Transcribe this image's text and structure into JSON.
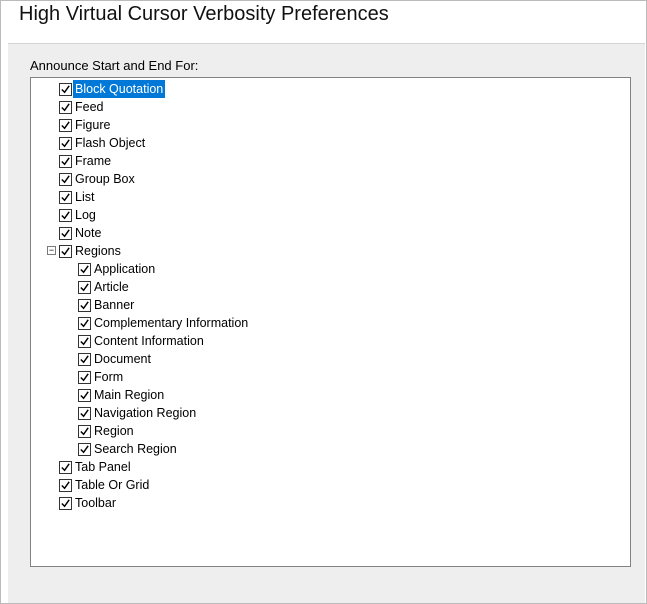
{
  "dialog": {
    "title": "High Virtual Cursor Verbosity Preferences",
    "section_label": "Announce Start and End For:"
  },
  "tree": {
    "items": [
      {
        "label": "Block Quotation",
        "checked": true,
        "level": 0,
        "selected": true,
        "expandable": false
      },
      {
        "label": "Feed",
        "checked": true,
        "level": 0,
        "selected": false,
        "expandable": false
      },
      {
        "label": "Figure",
        "checked": true,
        "level": 0,
        "selected": false,
        "expandable": false
      },
      {
        "label": "Flash Object",
        "checked": true,
        "level": 0,
        "selected": false,
        "expandable": false
      },
      {
        "label": "Frame",
        "checked": true,
        "level": 0,
        "selected": false,
        "expandable": false
      },
      {
        "label": "Group Box",
        "checked": true,
        "level": 0,
        "selected": false,
        "expandable": false
      },
      {
        "label": "List",
        "checked": true,
        "level": 0,
        "selected": false,
        "expandable": false
      },
      {
        "label": "Log",
        "checked": true,
        "level": 0,
        "selected": false,
        "expandable": false
      },
      {
        "label": "Note",
        "checked": true,
        "level": 0,
        "selected": false,
        "expandable": false
      },
      {
        "label": "Regions",
        "checked": true,
        "level": 0,
        "selected": false,
        "expandable": true,
        "expanded": true
      },
      {
        "label": "Application",
        "checked": true,
        "level": 1,
        "selected": false,
        "expandable": false
      },
      {
        "label": "Article",
        "checked": true,
        "level": 1,
        "selected": false,
        "expandable": false
      },
      {
        "label": "Banner",
        "checked": true,
        "level": 1,
        "selected": false,
        "expandable": false
      },
      {
        "label": "Complementary Information",
        "checked": true,
        "level": 1,
        "selected": false,
        "expandable": false
      },
      {
        "label": "Content Information",
        "checked": true,
        "level": 1,
        "selected": false,
        "expandable": false
      },
      {
        "label": "Document",
        "checked": true,
        "level": 1,
        "selected": false,
        "expandable": false
      },
      {
        "label": "Form",
        "checked": true,
        "level": 1,
        "selected": false,
        "expandable": false
      },
      {
        "label": "Main Region",
        "checked": true,
        "level": 1,
        "selected": false,
        "expandable": false
      },
      {
        "label": "Navigation Region",
        "checked": true,
        "level": 1,
        "selected": false,
        "expandable": false
      },
      {
        "label": "Region",
        "checked": true,
        "level": 1,
        "selected": false,
        "expandable": false
      },
      {
        "label": "Search Region",
        "checked": true,
        "level": 1,
        "selected": false,
        "expandable": false
      },
      {
        "label": "Tab Panel",
        "checked": true,
        "level": 0,
        "selected": false,
        "expandable": false
      },
      {
        "label": "Table Or Grid",
        "checked": true,
        "level": 0,
        "selected": false,
        "expandable": false
      },
      {
        "label": "Toolbar",
        "checked": true,
        "level": 0,
        "selected": false,
        "expandable": false
      }
    ]
  }
}
